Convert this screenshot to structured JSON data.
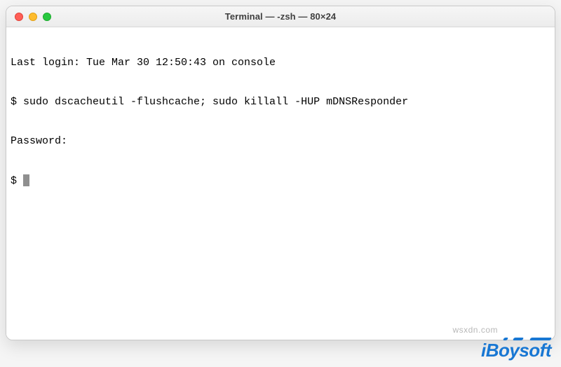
{
  "window": {
    "title": "Terminal — -zsh — 80×24"
  },
  "terminal": {
    "lines": {
      "last_login": "Last login: Tue Mar 30 12:50:43 on console",
      "command_line": "$ sudo dscacheutil -flushcache; sudo killall -HUP mDNSResponder",
      "password_prompt": "Password:",
      "prompt": "$ "
    }
  },
  "watermark": {
    "text": "wsxdn.com",
    "brand": "iBoysoft"
  }
}
